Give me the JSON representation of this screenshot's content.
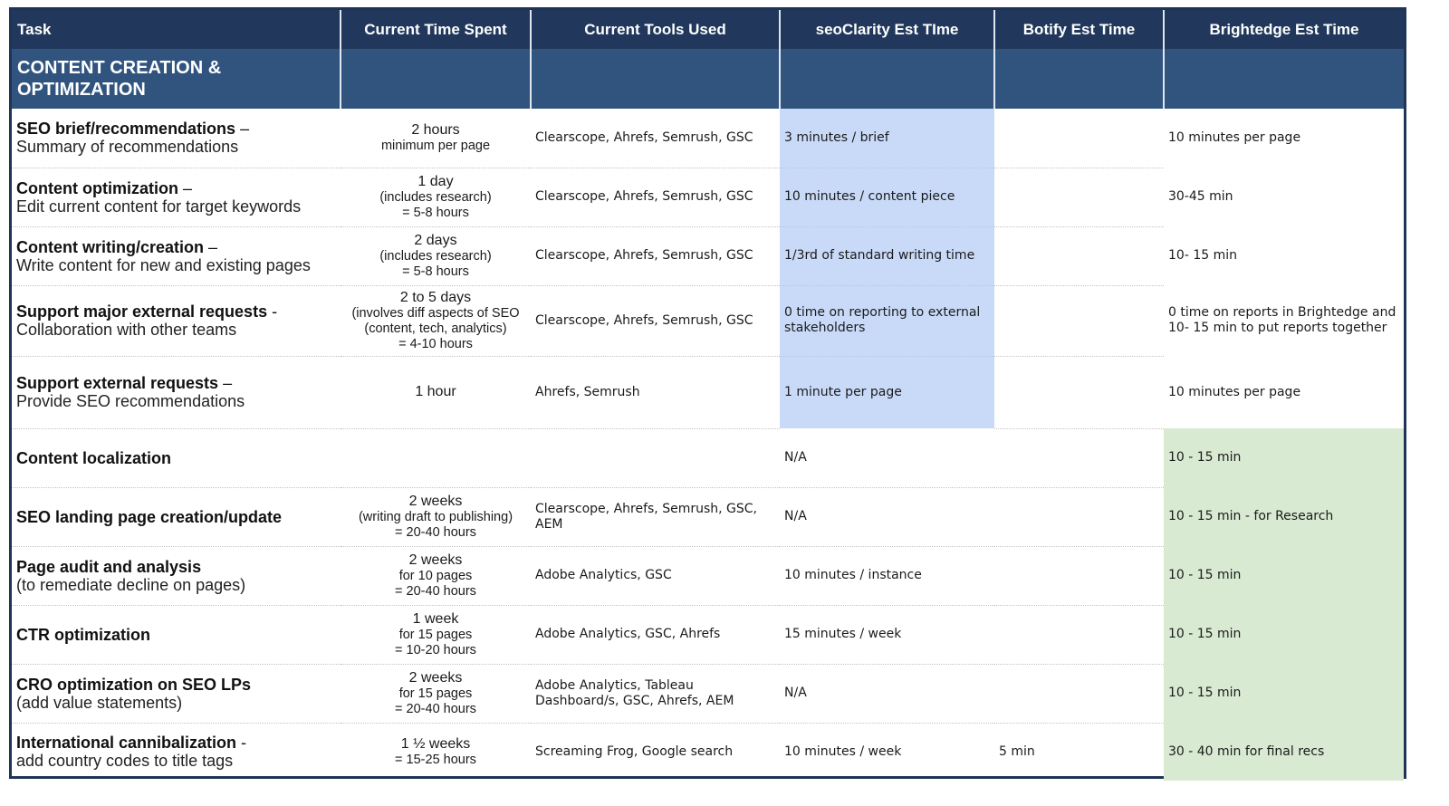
{
  "headers": [
    "Task",
    "Current Time Spent",
    "Current Tools Used",
    "seoClarity Est TIme",
    "Botify Est Time",
    "Brightedge Est Time"
  ],
  "section": {
    "title_line1": "CONTENT CREATION &",
    "title_line2": "OPTIMIZATION"
  },
  "colors": {
    "header_bg": "#21385c",
    "section_bg": "#31547f",
    "seoclarity_highlight": "#c9daf8",
    "brightedge_highlight": "#d9ead3",
    "border": "#1e3558"
  },
  "rows": [
    {
      "task_title": "SEO brief/recommendations",
      "task_title_suffix": " –",
      "task_sub": "Summary of recommendations",
      "time_lines": [
        "2 hours",
        "minimum per page"
      ],
      "tools": "Clearscope, Ahrefs, Semrush, GSC",
      "seoclarity": "3 minutes / brief",
      "botify": "",
      "brightedge": "10 minutes per page"
    },
    {
      "task_title": "Content optimization",
      "task_title_suffix": " –",
      "task_sub": "Edit current content for target keywords",
      "time_lines": [
        "1 day",
        "(includes research)",
        "= 5-8 hours"
      ],
      "tools": "Clearscope, Ahrefs, Semrush, GSC",
      "seoclarity": "10 minutes / content piece",
      "botify": "",
      "brightedge": "30-45 min"
    },
    {
      "task_title": "Content writing/creation",
      "task_title_suffix": " –",
      "task_sub": "Write content for new and existing pages",
      "time_lines": [
        "2 days",
        "(includes research)",
        "= 5-8 hours"
      ],
      "tools": "Clearscope, Ahrefs, Semrush, GSC",
      "seoclarity": "1/3rd of standard writing time",
      "botify": "",
      "brightedge": "10- 15 min"
    },
    {
      "task_title": "Support major external requests",
      "task_title_suffix": " -",
      "task_sub": "Collaboration with other teams",
      "time_lines": [
        "2 to 5 days",
        "(involves diff aspects of SEO",
        "(content, tech, analytics)",
        "= 4-10 hours"
      ],
      "tools": "Clearscope, Ahrefs, Semrush, GSC",
      "seoclarity": "0 time on reporting to external stakeholders",
      "botify": "",
      "brightedge": "0 time on reports in Brightedge and 10- 15 min to put reports together"
    },
    {
      "task_title": "Support external requests",
      "task_title_suffix": " –",
      "task_sub": "Provide SEO recommendations",
      "time_lines": [
        "1 hour"
      ],
      "tools": "Ahrefs, Semrush",
      "seoclarity": "1 minute per page",
      "botify": "",
      "brightedge": "10 minutes per page"
    },
    {
      "task_title": "Content localization",
      "task_title_suffix": "",
      "task_sub": "",
      "time_lines": [],
      "tools": "",
      "seoclarity": "N/A",
      "botify": "",
      "brightedge": "10 - 15 min"
    },
    {
      "task_title": "SEO landing page creation/update",
      "task_title_suffix": "",
      "task_sub": "",
      "time_lines": [
        "2 weeks",
        "(writing draft to publishing)",
        "= 20-40 hours"
      ],
      "tools": "Clearscope, Ahrefs, Semrush, GSC, AEM",
      "seoclarity": "N/A",
      "botify": "",
      "brightedge": "10 - 15 min - for Research"
    },
    {
      "task_title": "Page audit and analysis",
      "task_title_suffix": "",
      "task_sub": "(to remediate decline on pages)",
      "time_lines": [
        "2 weeks",
        "for 10 pages",
        "= 20-40 hours"
      ],
      "tools": "Adobe Analytics, GSC",
      "seoclarity": "10 minutes / instance",
      "botify": "",
      "brightedge": "10 - 15 min"
    },
    {
      "task_title": "CTR optimization",
      "task_title_suffix": "",
      "task_sub": "",
      "time_lines": [
        "1 week",
        "for 15 pages",
        "= 10-20 hours"
      ],
      "tools": "Adobe Analytics, GSC, Ahrefs",
      "seoclarity": "15 minutes / week",
      "botify": "",
      "brightedge": "10 - 15 min"
    },
    {
      "task_title": "CRO optimization on SEO LPs",
      "task_title_suffix": "",
      "task_sub": "(add value statements)",
      "time_lines": [
        "2 weeks",
        "for 15 pages",
        "= 20-40 hours"
      ],
      "tools": "Adobe Analytics, Tableau Dashboard/s, GSC, Ahrefs, AEM",
      "seoclarity": "N/A",
      "botify": "",
      "brightedge": "10 - 15 min"
    },
    {
      "task_title": "International cannibalization",
      "task_title_suffix": " -",
      "task_sub": "add country codes to title tags",
      "time_lines": [
        "1 ½ weeks",
        "= 15-25 hours"
      ],
      "tools": "Screaming Frog, Google search",
      "seoclarity": "10 minutes / week",
      "botify": "5 min",
      "brightedge": "30 - 40 min for final recs"
    }
  ]
}
